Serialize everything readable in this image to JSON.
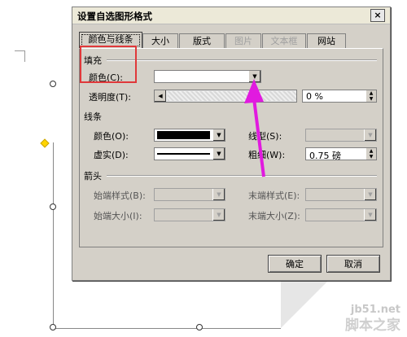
{
  "dialog": {
    "title": "设置自选图形格式",
    "close_label": "×"
  },
  "tabs": [
    {
      "label": "颜色与线条"
    },
    {
      "label": "大小"
    },
    {
      "label": "版式"
    },
    {
      "label": "图片"
    },
    {
      "label": "文本框"
    },
    {
      "label": "网站"
    }
  ],
  "fill": {
    "section_label": "填充",
    "color_label": "颜色(C):",
    "transparency_label": "透明度(T):",
    "transparency_value": "0 %"
  },
  "line": {
    "section_label": "线条",
    "color_label": "颜色(O):",
    "dash_label": "虚实(D):",
    "style_label": "线型(S):",
    "weight_label": "粗细(W):",
    "weight_value": "0.75 磅"
  },
  "arrows": {
    "section_label": "箭头",
    "begin_style_label": "始端样式(B):",
    "end_style_label": "末端样式(E):",
    "begin_size_label": "始端大小(I):",
    "end_size_label": "末端大小(Z):"
  },
  "buttons": {
    "ok": "确定",
    "cancel": "取消"
  },
  "watermark": {
    "site": "jb51.net",
    "name": "脚本之家"
  },
  "colors": {
    "highlight_box": "#e0383a",
    "annotation_arrow": "#e11adf",
    "selection_handle": "#ffd400"
  }
}
